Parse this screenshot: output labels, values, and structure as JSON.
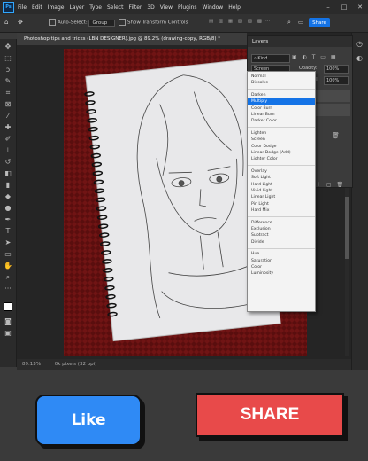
{
  "menubar": {
    "logo": "Ps",
    "items": [
      "File",
      "Edit",
      "Image",
      "Layer",
      "Type",
      "Select",
      "Filter",
      "3D",
      "View",
      "Plugins",
      "Window",
      "Help"
    ],
    "controls": [
      "–",
      "□",
      "✕"
    ]
  },
  "options": {
    "auto_select_label": "Auto-Select:",
    "auto_select_value": "Group",
    "transform_label": "Show Transform Controls",
    "share_label": "Share"
  },
  "document": {
    "tab_title": "Photoshop tips and tricks (LBN DESIGNER).jpg @ 89.2% (drawing-copy, RGB/8) *",
    "zoom": "89.13%",
    "status": "0k pixels (32 ppi)"
  },
  "layers_panel": {
    "title": "Layers",
    "kind_label": "Kind",
    "mode_value": "Screen",
    "opacity_label": "Opacity:",
    "opacity_value": "100%",
    "fill_label": "Fill:",
    "fill_value": "100%"
  },
  "blend_modes": {
    "groups": [
      [
        "Normal",
        "Dissolve"
      ],
      [
        "Darken",
        "Multiply",
        "Color Burn",
        "Linear Burn",
        "Darker Color"
      ],
      [
        "Lighten",
        "Screen",
        "Color Dodge",
        "Linear Dodge (Add)",
        "Lighter Color"
      ],
      [
        "Overlay",
        "Soft Light",
        "Hard Light",
        "Vivid Light",
        "Linear Light",
        "Pin Light",
        "Hard Mix"
      ],
      [
        "Difference",
        "Exclusion",
        "Subtract",
        "Divide"
      ],
      [
        "Hue",
        "Saturation",
        "Color",
        "Luminosity"
      ]
    ],
    "selected": "Multiply"
  },
  "buttons": {
    "like": "Like",
    "share": "SHARE"
  },
  "colors": {
    "like_bg": "#2f8af5",
    "share_bg": "#e84a4a",
    "accent": "#1473e6"
  }
}
